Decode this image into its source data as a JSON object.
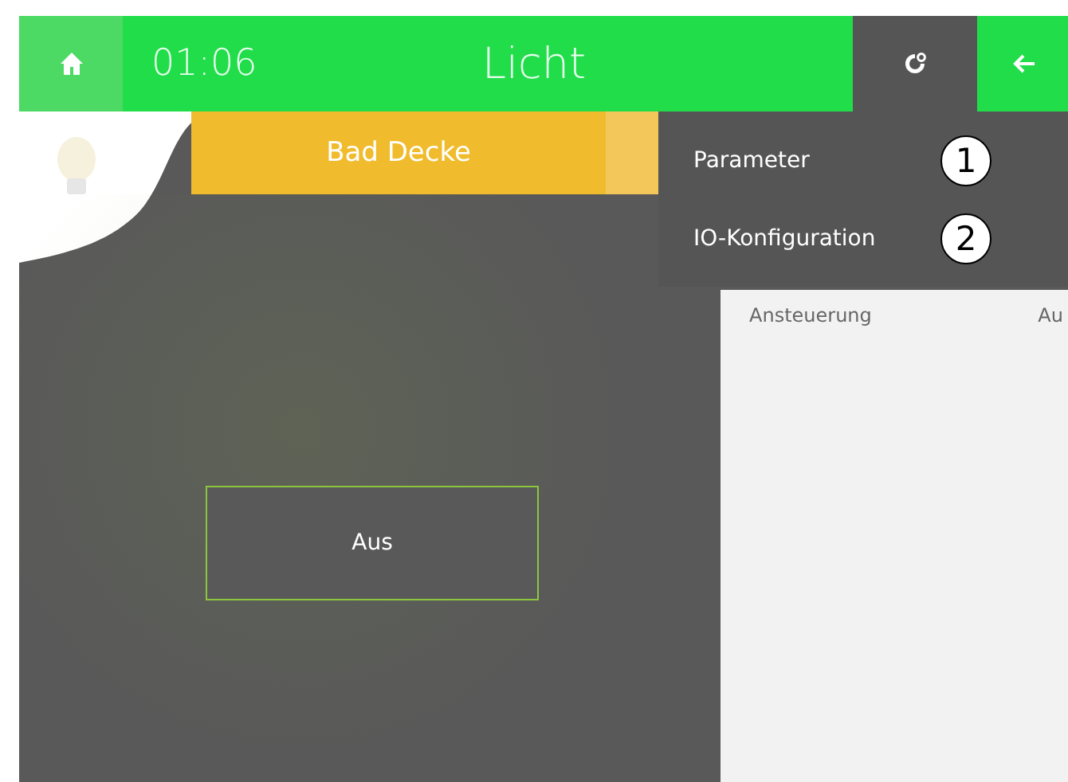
{
  "header": {
    "time": "01:06",
    "title": "Licht",
    "settings_open": true
  },
  "tabs": [
    {
      "label": "Bad Decke",
      "selected": true
    },
    {
      "selected": false
    }
  ],
  "switch_button": {
    "label": "Aus"
  },
  "menu": {
    "items": [
      {
        "label": "Parameter",
        "marker": "1"
      },
      {
        "label": "IO-Konfiguration",
        "marker": "2"
      }
    ]
  },
  "panel": {
    "column_1": "Ansteuerung",
    "column_2": "Au"
  }
}
